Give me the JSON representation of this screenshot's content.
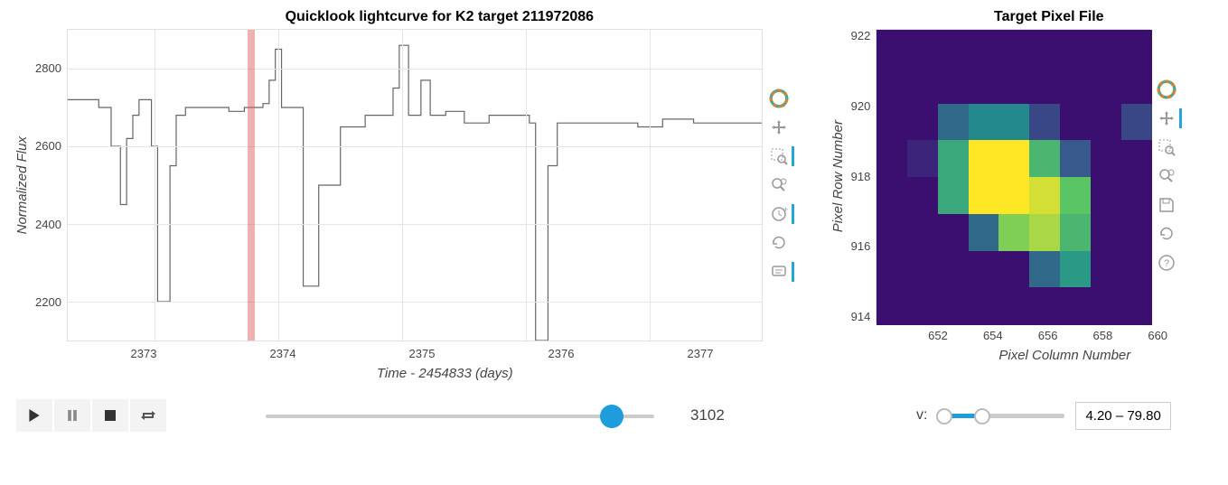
{
  "lightcurve": {
    "title": "Quicklook lightcurve for K2 target 211972086",
    "ylabel": "Normalized Flux",
    "xlabel": "Time - 2454833 (days)",
    "y_ticks": [
      "2800",
      "2600",
      "2400",
      "2200"
    ],
    "x_ticks": [
      "2373",
      "2374",
      "2375",
      "2376",
      "2377"
    ],
    "marker_x": 2373.75
  },
  "targetpixel": {
    "title": "Target Pixel File",
    "ylabel": "Pixel Row Number",
    "xlabel": "Pixel Column Number",
    "y_ticks": [
      "922",
      "920",
      "918",
      "916",
      "914"
    ],
    "x_ticks": [
      "652",
      "654",
      "656",
      "658",
      "660"
    ]
  },
  "toolbar_lc": [
    "bokeh",
    "pan",
    "box-zoom",
    "wheel-zoom",
    "lasso",
    "reset",
    "hover"
  ],
  "toolbar_tp": [
    "bokeh",
    "pan",
    "box-zoom",
    "wheel-zoom",
    "save",
    "reset",
    "help"
  ],
  "controls": {
    "slider_value": "3102",
    "slider_pos": 0.915,
    "v_label": "v:",
    "v_range": "4.20 – 79.80",
    "v_low": 0.05,
    "v_high": 0.35
  },
  "chart_data": {
    "lightcurve": {
      "type": "line",
      "title": "Quicklook lightcurve for K2 target 211972086",
      "xlabel": "Time - 2454833 (days)",
      "ylabel": "Normalized Flux",
      "xlim": [
        2372.3,
        2377.9
      ],
      "ylim": [
        2100,
        2900
      ],
      "marker_x": 2373.75,
      "x": [
        2372.3,
        2372.5,
        2372.6,
        2372.7,
        2372.75,
        2372.8,
        2372.85,
        2372.9,
        2372.95,
        2373.0,
        2373.05,
        2373.1,
        2373.15,
        2373.2,
        2373.3,
        2373.5,
        2373.7,
        2373.75,
        2373.85,
        2373.9,
        2373.95,
        2374.0,
        2374.05,
        2374.1,
        2374.15,
        2374.25,
        2374.4,
        2374.6,
        2374.8,
        2374.9,
        2374.95,
        2375.0,
        2375.1,
        2375.2,
        2375.25,
        2375.3,
        2375.4,
        2375.6,
        2375.8,
        2376.0,
        2376.05,
        2376.1,
        2376.15,
        2376.2,
        2376.3,
        2376.5,
        2376.8,
        2377.0,
        2377.2,
        2377.5,
        2377.9
      ],
      "y": [
        2720,
        2720,
        2700,
        2600,
        2450,
        2620,
        2680,
        2720,
        2720,
        2600,
        2200,
        2200,
        2550,
        2680,
        2700,
        2700,
        2690,
        2700,
        2700,
        2710,
        2770,
        2850,
        2700,
        2700,
        2700,
        2240,
        2500,
        2650,
        2680,
        2680,
        2750,
        2860,
        2680,
        2770,
        2680,
        2680,
        2690,
        2660,
        2680,
        2680,
        2660,
        2100,
        2100,
        2550,
        2660,
        2660,
        2660,
        2650,
        2670,
        2660,
        2660
      ]
    },
    "target_pixel": {
      "type": "heatmap",
      "title": "Target Pixel File",
      "xlabel": "Pixel Column Number",
      "ylabel": "Pixel Row Number",
      "xlim": [
        651,
        660
      ],
      "ylim": [
        914,
        922
      ],
      "grid": [
        [
          4,
          4,
          4,
          4,
          4,
          4,
          4,
          4,
          4
        ],
        [
          4,
          4,
          4,
          4,
          4,
          30,
          45,
          4,
          4
        ],
        [
          4,
          4,
          4,
          30,
          65,
          70,
          55,
          4,
          4
        ],
        [
          4,
          4,
          50,
          80,
          80,
          75,
          60,
          4,
          4
        ],
        [
          4,
          10,
          50,
          80,
          80,
          55,
          25,
          4,
          4
        ],
        [
          4,
          4,
          30,
          40,
          40,
          20,
          4,
          4,
          20
        ],
        [
          4,
          4,
          4,
          4,
          4,
          4,
          4,
          4,
          4
        ],
        [
          4,
          4,
          4,
          4,
          4,
          4,
          4,
          4,
          4
        ]
      ],
      "col_start": 651,
      "row_start": 914
    }
  }
}
